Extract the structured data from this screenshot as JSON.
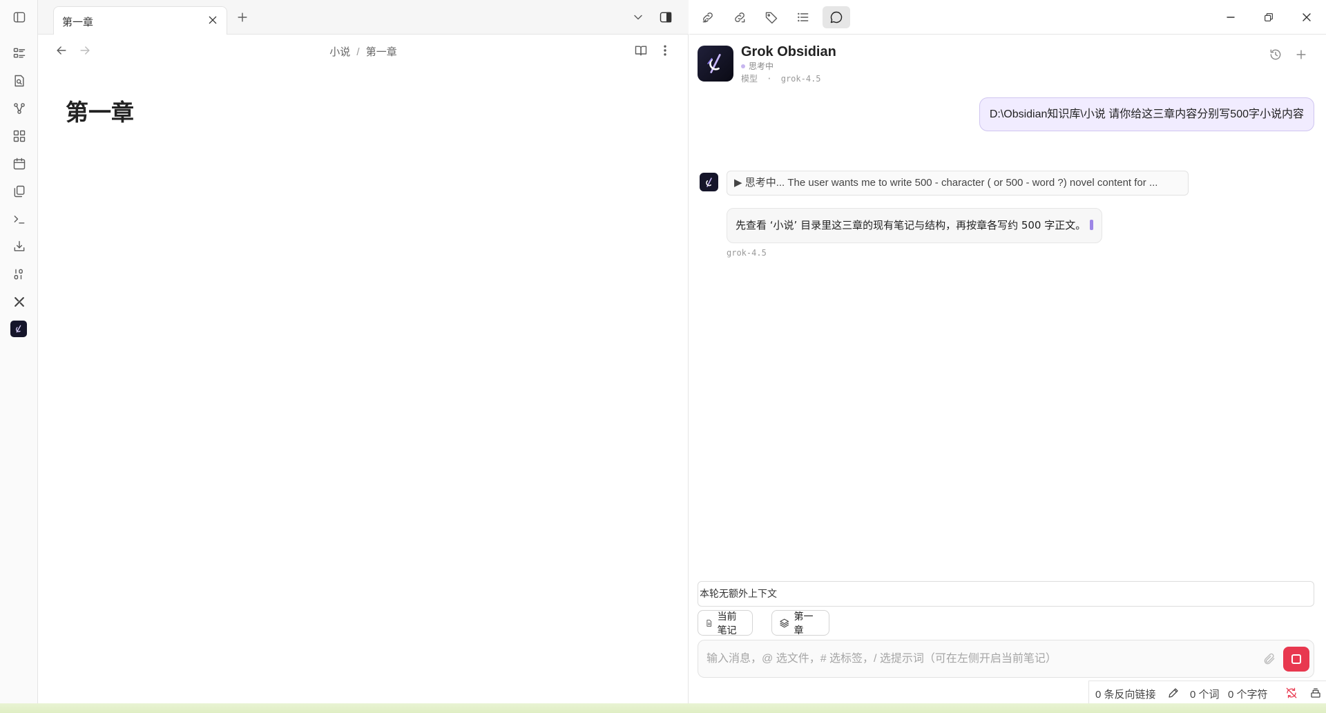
{
  "tab": {
    "title": "第一章"
  },
  "editor": {
    "breadcrumb": {
      "folder": "小说",
      "separator": "/",
      "note": "第一章"
    },
    "note_title": "第一章"
  },
  "panel": {
    "assistant_name": "Grok Obsidian",
    "status": "思考中",
    "model_label": "模型",
    "model_dot": "·",
    "model_name": "grok-4.5"
  },
  "chat": {
    "user_message": "D:\\Obsidian知识库\\小说 请你给这三章内容分别写500字小说内容",
    "thinking": "▶ 思考中... The user wants me to write 500 - character ( or 500 - word ?) novel content for ...",
    "answer": "先查看 ‘小说’ 目录里这三章的现有笔记与结构，再按章各写约 500 字正文。",
    "answer_model": "grok-4.5"
  },
  "context": {
    "summary": "本轮无额外上下文",
    "chips": [
      "当前笔记",
      "第一章"
    ]
  },
  "composer": {
    "placeholder": "输入消息，@ 选文件，# 选标签，/ 选提示词（可在左侧开启当前笔记）"
  },
  "statusbar": {
    "backlinks": "0 条反向链接",
    "words": "0 个词",
    "chars": "0 个字符"
  },
  "colors": {
    "accent": "#9d86e6",
    "user_bubble": "#f1ecff",
    "stop_button": "#e8384f",
    "sync_warning": "#e8384f"
  },
  "icons": {
    "ribbon": [
      "file-explorer-icon",
      "search-icon",
      "graph-icon",
      "canvas-icon",
      "calendar-icon",
      "templates-icon",
      "terminal-icon",
      "import-icon",
      "numbers-icon",
      "tools-icon",
      "grok-logo-icon"
    ],
    "right_toolbar": [
      "backlinks-icon",
      "outgoing-links-icon",
      "tags-icon",
      "outline-icon",
      "chat-icon"
    ]
  }
}
